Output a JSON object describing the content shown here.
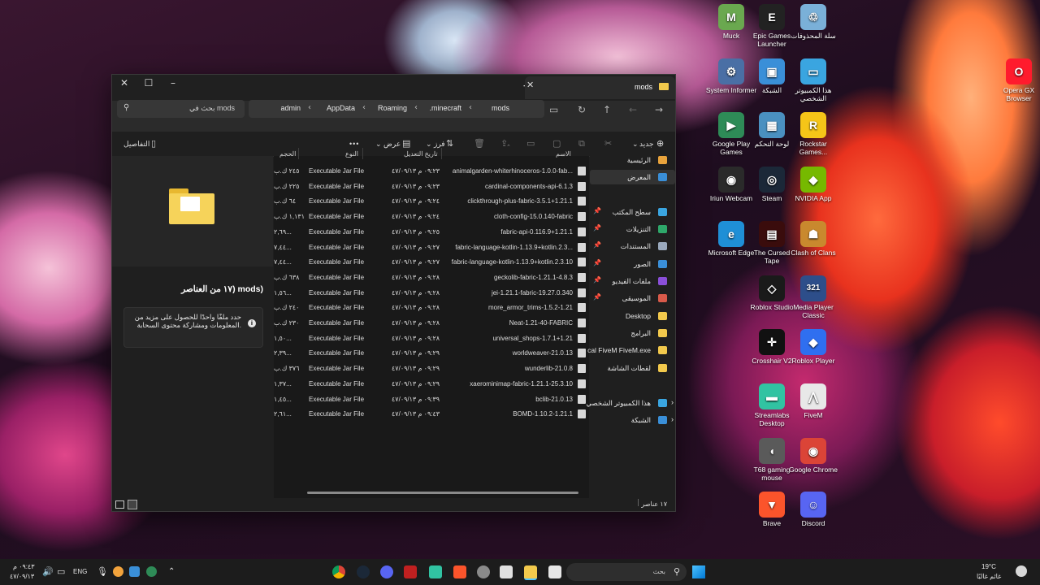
{
  "desktop_icons": [
    {
      "label": "Muck",
      "icon": "muck-icon",
      "color": "#6aa84f",
      "glyph": "M"
    },
    {
      "label": "Epic Games Launcher",
      "icon": "epic-games-icon",
      "color": "#222222",
      "glyph": "E"
    },
    {
      "label": "سلة المحذوفات",
      "icon": "recycle-bin-icon",
      "color": "#7ab0d8",
      "glyph": "♲"
    },
    {
      "label": "System Informer",
      "icon": "system-informer-icon",
      "color": "#4a6fa5",
      "glyph": "⚙"
    },
    {
      "label": "الشبكة",
      "icon": "network-icon",
      "color": "#3a8fd8",
      "glyph": "▣"
    },
    {
      "label": "هذا الكمبيوتر الشخصي",
      "icon": "this-pc-icon",
      "color": "#3aa5e0",
      "glyph": "▭"
    },
    {
      "label": "Google Play Games",
      "icon": "google-play-games-icon",
      "color": "#2e8b57",
      "glyph": "▶"
    },
    {
      "label": "لوحة التحكم",
      "icon": "control-panel-icon",
      "color": "#4a90c0",
      "glyph": "▦"
    },
    {
      "label": "Rockstar Games...",
      "icon": "rockstar-icon",
      "color": "#f5c518",
      "glyph": "R"
    },
    {
      "label": "Iriun Webcam",
      "icon": "iriun-webcam-icon",
      "color": "#2a2a2a",
      "glyph": "◉"
    },
    {
      "label": "Steam",
      "icon": "steam-icon",
      "color": "#1b2838",
      "glyph": "◎"
    },
    {
      "label": "NVIDIA App",
      "icon": "nvidia-icon",
      "color": "#76b900",
      "glyph": "◆"
    },
    {
      "label": "Microsoft Edge",
      "icon": "edge-icon",
      "color": "#1f8fd6",
      "glyph": "e"
    },
    {
      "label": "The Cursed Tape",
      "icon": "cursed-tape-icon",
      "color": "#3a0c0c",
      "glyph": "▤"
    },
    {
      "label": "Clash of Clans",
      "icon": "clash-of-clans-icon",
      "color": "#c9892e",
      "glyph": "☗"
    },
    {
      "label": "Roblox Studio",
      "icon": "roblox-studio-icon",
      "color": "#1a1a1a",
      "glyph": "◇"
    },
    {
      "label": "Media Player Classic",
      "icon": "media-player-classic-icon",
      "color": "#2d4e8a",
      "glyph": "321"
    },
    {
      "label": "Crosshair V2",
      "icon": "crosshair-icon",
      "color": "#111111",
      "glyph": "✛"
    },
    {
      "label": "Roblox Player",
      "icon": "roblox-player-icon",
      "color": "#2f6ff0",
      "glyph": "◆"
    },
    {
      "label": "Streamlabs Desktop",
      "icon": "streamlabs-icon",
      "color": "#31c3a2",
      "glyph": "▬"
    },
    {
      "label": "FiveM",
      "icon": "fivem-icon",
      "color": "#e8e8e8",
      "glyph": "⋀"
    },
    {
      "label": "T68 gaming mouse",
      "icon": "gaming-mouse-icon",
      "color": "#5a5a5a",
      "glyph": "◖"
    },
    {
      "label": "Google Chrome",
      "icon": "chrome-icon",
      "color": "#db4437",
      "glyph": "◉"
    },
    {
      "label": "Brave",
      "icon": "brave-icon",
      "color": "#fb542b",
      "glyph": "▼"
    },
    {
      "label": "Discord",
      "icon": "discord-icon",
      "color": "#5865f2",
      "glyph": "☺"
    },
    {
      "label": "Opera GX Browser",
      "icon": "opera-gx-icon",
      "color": "#ff1b2d",
      "glyph": "O"
    }
  ],
  "explorer": {
    "tab_title": "mods",
    "search_placeholder": "بحث في mods",
    "breadcrumb": [
      "admin",
      "AppData",
      "Roaming",
      ".minecraft",
      "mods"
    ],
    "commands": {
      "new": "جديد",
      "sort": "فرز",
      "view": "عرض",
      "more": "•••",
      "details": "التفاصيل"
    },
    "columns": {
      "name": "الاسم",
      "date": "تاريخ التعديل",
      "type": "النوع",
      "size": "الحجم"
    },
    "files": [
      {
        "name": "animalgarden-whiterhinoceros-1.0.0-fab...",
        "date": "٠٩:٢٣ م ٤٧/٠٩/١٣",
        "type": "Executable Jar File",
        "size": "٢٤٥ ك.ب"
      },
      {
        "name": "cardinal-components-api-6.1.3",
        "date": "٠٩:٢٣ م ٤٧/٠٩/١٣",
        "type": "Executable Jar File",
        "size": "٢٢٥ ك.ب"
      },
      {
        "name": "clickthrough-plus-fabric-3.5.1+1.21.1",
        "date": "٠٩:٢٤ م ٤٧/٠٩/١٣",
        "type": "Executable Jar File",
        "size": "٦٤ ك.ب"
      },
      {
        "name": "cloth-config-15.0.140-fabric",
        "date": "٠٩:٢٤ م ٤٧/٠٩/١٣",
        "type": "Executable Jar File",
        "size": "١,١٣١ ك.ب"
      },
      {
        "name": "fabric-api-0.116.9+1.21.1",
        "date": "٠٩:٢٥ م ٤٧/٠٩/١٣",
        "type": "Executable Jar File",
        "size": "٢,٦٩..."
      },
      {
        "name": "fabric-language-kotlin-1.13.9+kotlin.2.3...",
        "date": "٠٩:٢٧ م ٤٧/٠٩/١٣",
        "type": "Executable Jar File",
        "size": "٧,٤٤..."
      },
      {
        "name": "fabric-language-kotlin-1.13.9+kotlin.2.3.10",
        "date": "٠٩:٢٧ م ٤٧/٠٩/١٣",
        "type": "Executable Jar File",
        "size": "٧,٤٤..."
      },
      {
        "name": "geckolib-fabric-1.21.1-4.8.3",
        "date": "٠٩:٢٨ م ٤٧/٠٩/١٣",
        "type": "Executable Jar File",
        "size": "٦٣٨ ك.ب"
      },
      {
        "name": "jei-1.21.1-fabric-19.27.0.340",
        "date": "٠٩:٢٨ م ٤٧/٠٩/١٣",
        "type": "Executable Jar File",
        "size": "١,٥٦..."
      },
      {
        "name": "more_armor_trims-1.5.2-1.21",
        "date": "٠٩:٢٨ م ٤٧/٠٩/١٣",
        "type": "Executable Jar File",
        "size": "٢٤٠ ك.ب"
      },
      {
        "name": "Neat-1.21-40-FABRIC",
        "date": "٠٩:٢٨ م ٤٧/٠٩/١٣",
        "type": "Executable Jar File",
        "size": "٢٣٠ ك.ب"
      },
      {
        "name": "universal_shops-1.7.1+1.21",
        "date": "٠٩:٢٨ م ٤٧/٠٩/١٣",
        "type": "Executable Jar File",
        "size": "١,٥٠..."
      },
      {
        "name": "worldweaver-21.0.13",
        "date": "٠٩:٢٩ م ٤٧/٠٩/١٣",
        "type": "Executable Jar File",
        "size": "٢,٣٩..."
      },
      {
        "name": "wunderlib-21.0.8",
        "date": "٠٩:٢٩ م ٤٧/٠٩/١٣",
        "type": "Executable Jar File",
        "size": "٣٧٦ ك.ب"
      },
      {
        "name": "xaerominimap-fabric-1.21.1-25.3.10",
        "date": "٠٩:٢٩ م ٤٧/٠٩/١٣",
        "type": "Executable Jar File",
        "size": "١,٣٧..."
      },
      {
        "name": "bclib-21.0.13",
        "date": "٠٩:٣٩ م ٤٧/٠٩/١٣",
        "type": "Executable Jar File",
        "size": "١,٤٥..."
      },
      {
        "name": "BOMD-1.10.2-1.21.1",
        "date": "٠٩:٤٣ م ٤٧/٠٩/١٣",
        "type": "Executable Jar File",
        "size": "٢,٦١..."
      }
    ],
    "nav": [
      {
        "label": "الرئيسية",
        "icon": "home-icon",
        "color": "#e8a33c",
        "pinned": false
      },
      {
        "label": "المعرض",
        "icon": "gallery-icon",
        "color": "#3a8fd8",
        "pinned": false
      },
      {
        "label": "سطح المكتب",
        "icon": "desktop-folder-icon",
        "color": "#3aa5e0",
        "pinned": true
      },
      {
        "label": "التنزيلات",
        "icon": "downloads-icon",
        "color": "#2ea86a",
        "pinned": true
      },
      {
        "label": "المستندات",
        "icon": "documents-icon",
        "color": "#9aa9bd",
        "pinned": true
      },
      {
        "label": "الصور",
        "icon": "pictures-icon",
        "color": "#3a8fd8",
        "pinned": true
      },
      {
        "label": "ملفات الفيديو",
        "icon": "videos-icon",
        "color": "#8a4fd8",
        "pinned": true
      },
      {
        "label": "الموسيقى",
        "icon": "music-icon",
        "color": "#d85a4a",
        "pinned": true
      },
      {
        "label": "Desktop",
        "icon": "folder-icon",
        "color": "#f2c94c",
        "pinned": false
      },
      {
        "label": "البرامج",
        "icon": "folder-icon",
        "color": "#f2c94c",
        "pinned": false
      },
      {
        "label": "cal FiveM FiveM.exe",
        "icon": "folder-icon",
        "color": "#f2c94c",
        "pinned": false
      },
      {
        "label": "لقطات الشاشة",
        "icon": "folder-icon",
        "color": "#f2c94c",
        "pinned": false
      },
      {
        "label": "هذا الكمبيوتر الشخصي",
        "icon": "this-pc-icon",
        "color": "#3aa5e0",
        "pinned": false
      },
      {
        "label": "الشبكة",
        "icon": "network-icon",
        "color": "#3a8fd8",
        "pinned": false
      }
    ],
    "preview": {
      "title": "١٧ من العناصر) mods)",
      "info": "حدد ملفًا واحدًا للحصول على مزيد من المعلومات ومشاركة محتوى السحابة."
    },
    "status": "١٧ عناصر"
  },
  "taskbar": {
    "time": "٠٩:٤٣ م",
    "date": "٤٧/٠٩/١٣",
    "lang": "ENG",
    "search_placeholder": "بحث",
    "weather_temp": "19°C",
    "weather_desc": "غائم غالبًا"
  }
}
